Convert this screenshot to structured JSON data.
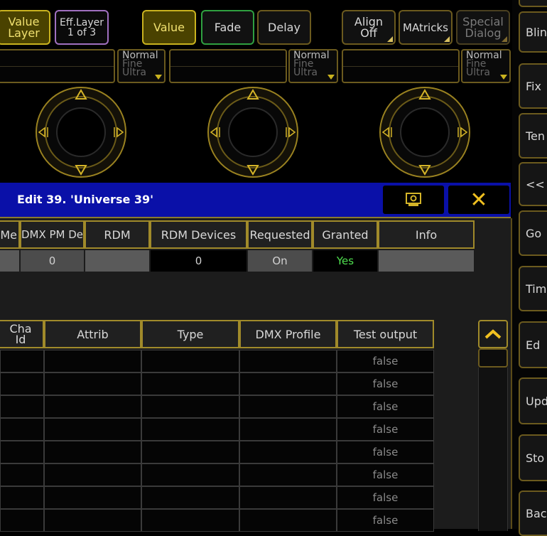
{
  "top_buttons": {
    "value_layer": "Value\nLayer",
    "eff_layer_line1": "Eff.Layer",
    "eff_layer_line2": "1 of 3",
    "value": "Value",
    "fade": "Fade",
    "delay": "Delay",
    "align_line1": "Align",
    "align_line2": "Off",
    "matricks": "MAtricks",
    "special_line1": "Special",
    "special_line2": "Dialog"
  },
  "encoders": {
    "resolution_normal": "Normal",
    "resolution_fine": "Fine",
    "resolution_ultra": "Ultra"
  },
  "window": {
    "title": "Edit 39. 'Universe 39'",
    "close_symbol": "✕"
  },
  "upper_table": {
    "headers": [
      "Me",
      "DMX PM De",
      "RDM",
      "RDM Devices",
      "Requested",
      "Granted",
      "Info"
    ],
    "row": [
      "",
      "0",
      "",
      "0",
      "On",
      "Yes",
      ""
    ]
  },
  "lower_table": {
    "headers": [
      "Cha\nId",
      "Attrib",
      "Type",
      "DMX Profile",
      "Test output"
    ],
    "test_output_values": [
      "false",
      "false",
      "false",
      "false",
      "false",
      "false",
      "false",
      "false"
    ]
  },
  "side_panel": {
    "items": [
      "Blin",
      "Fix",
      "Ten",
      "<<",
      "Go",
      "Tim",
      "Ed",
      "Upd",
      "Sto",
      "Bac"
    ]
  },
  "colors": {
    "accent_gold": "#c9b21f",
    "title_blue": "#0a10a8",
    "granted_green": "#4fe04f"
  }
}
